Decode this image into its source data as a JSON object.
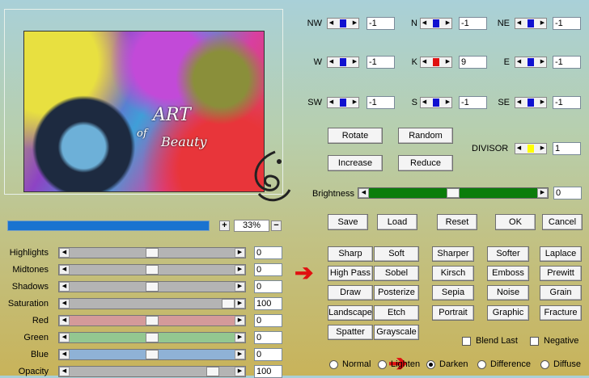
{
  "preview": {
    "logo_line1": "ART",
    "logo_line2": "of",
    "logo_line3": "Beauty"
  },
  "zoom": {
    "plus": "+",
    "value": "33%",
    "minus": "−",
    "progress_fraction": 1.0
  },
  "sliders": [
    {
      "label": "Highlights",
      "value": "0",
      "track_color": "#b4b4b4",
      "position": 0.5
    },
    {
      "label": "Midtones",
      "value": "0",
      "track_color": "#b4b4b4",
      "position": 0.5
    },
    {
      "label": "Shadows",
      "value": "0",
      "track_color": "#b4b4b4",
      "position": 0.5
    },
    {
      "label": "Saturation",
      "value": "100",
      "track_color": "#b4b4b4",
      "position": 1.0
    },
    {
      "label": "Red",
      "value": "0",
      "track_color": "#d49a9a",
      "position": 0.5
    },
    {
      "label": "Green",
      "value": "0",
      "track_color": "#93c790",
      "position": 0.5
    },
    {
      "label": "Blue",
      "value": "0",
      "track_color": "#8fb2d6",
      "position": 0.5
    },
    {
      "label": "Opacity",
      "value": "100",
      "track_color": "#b4b4b4",
      "position": 0.9
    }
  ],
  "matrix": [
    {
      "label": "NW",
      "value": "-1",
      "marker": "#1010d0"
    },
    {
      "label": "N",
      "value": "-1",
      "marker": "#1010d0"
    },
    {
      "label": "NE",
      "value": "-1",
      "marker": "#1010d0"
    },
    {
      "label": "W",
      "value": "-1",
      "marker": "#1010d0"
    },
    {
      "label": "K",
      "value": "9",
      "marker": "#e01010"
    },
    {
      "label": "E",
      "value": "-1",
      "marker": "#1010d0"
    },
    {
      "label": "SW",
      "value": "-1",
      "marker": "#1010d0"
    },
    {
      "label": "S",
      "value": "-1",
      "marker": "#1010d0"
    },
    {
      "label": "SE",
      "value": "-1",
      "marker": "#1010d0"
    }
  ],
  "buttons": {
    "rotate": "Rotate",
    "random": "Random",
    "increase": "Increase",
    "reduce": "Reduce",
    "save": "Save",
    "load": "Load",
    "reset": "Reset",
    "ok": "OK",
    "cancel": "Cancel"
  },
  "divisor": {
    "label": "DIVISOR",
    "value": "1",
    "marker": "#ffff00"
  },
  "brightness": {
    "label": "Brightness",
    "value": "0",
    "position": 0.5
  },
  "presets": [
    [
      "Sharp",
      "Soft",
      "Sharper",
      "Softer",
      "Laplace"
    ],
    [
      "High Pass",
      "Sobel",
      "Kirsch",
      "Emboss",
      "Prewitt"
    ],
    [
      "Draw",
      "Posterize",
      "Sepia",
      "Noise",
      "Grain"
    ],
    [
      "Landscape",
      "Etch",
      "Portrait",
      "Graphic",
      "Fracture"
    ],
    [
      "Spatter",
      "Grayscale"
    ]
  ],
  "checkboxes": {
    "blend_last": "Blend Last",
    "negative": "Negative"
  },
  "blend_modes": {
    "normal": "Normal",
    "lighten": "Lighten",
    "darken": "Darken",
    "difference": "Difference",
    "diffuse": "Diffuse",
    "selected": "darken"
  }
}
